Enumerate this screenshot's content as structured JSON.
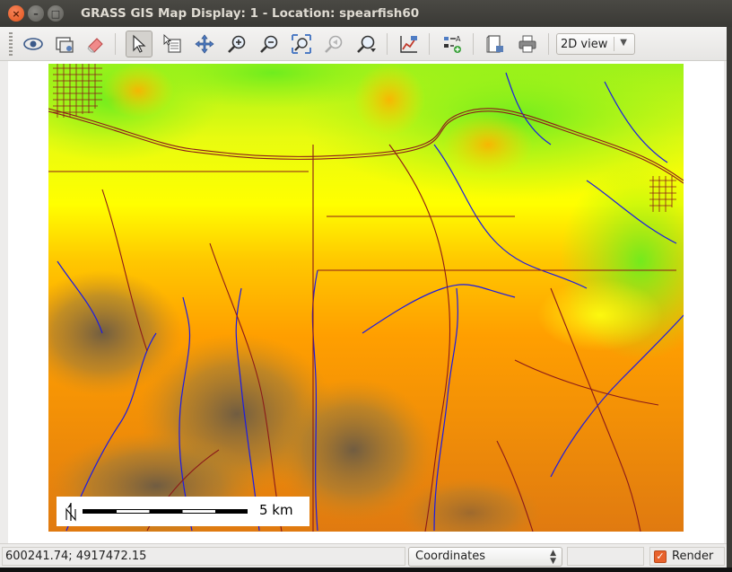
{
  "window": {
    "title": "GRASS GIS Map Display: 1  - Location: spearfish60",
    "controls": {
      "close": "×",
      "minimize": "–",
      "maximize": "□"
    }
  },
  "toolbar": {
    "tools": [
      {
        "name": "display-map-icon"
      },
      {
        "name": "render-map-icon"
      },
      {
        "name": "erase-display-icon"
      },
      {
        "name": "pointer-icon",
        "active": true
      },
      {
        "name": "query-icon"
      },
      {
        "name": "pan-icon"
      },
      {
        "name": "zoom-in-icon"
      },
      {
        "name": "zoom-out-icon"
      },
      {
        "name": "zoom-extent-icon"
      },
      {
        "name": "zoom-back-icon"
      },
      {
        "name": "zoom-menu-icon"
      },
      {
        "name": "analyze-icon"
      },
      {
        "name": "overlay-icon"
      },
      {
        "name": "save-image-icon"
      },
      {
        "name": "print-icon"
      }
    ],
    "view_mode": "2D view"
  },
  "map": {
    "scale_label": "5  km",
    "north_arrow": "N",
    "colors": {
      "elev_low": "#7cf21c",
      "elev_mid": "#ffff00",
      "elev_high": "#ff9a00",
      "elev_peak": "#7a6a50",
      "streams": "#1a1ae6",
      "roads": "#8b1a1a"
    }
  },
  "statusbar": {
    "coordinates": "600241.74; 4917472.15",
    "mode": "Coordinates",
    "render_label": "Render",
    "render_checked": true
  }
}
